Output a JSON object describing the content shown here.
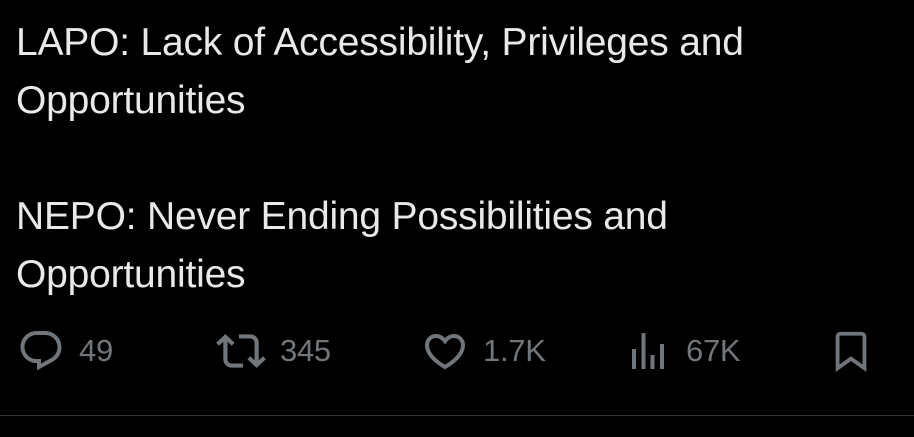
{
  "tweet": {
    "paragraphs": [
      "LAPO: Lack of Accessibility, Privileges and Opportunities",
      "NEPO: Never Ending Possibilities and Opportunities"
    ]
  },
  "actions": {
    "replies": "49",
    "reposts": "345",
    "likes": "1.7K",
    "views": "67K"
  },
  "colors": {
    "background": "#000000",
    "text": "#e7e9ea",
    "muted": "#71767b",
    "divider": "#2f3336"
  },
  "icons": [
    "reply-icon",
    "repost-icon",
    "like-icon",
    "views-icon",
    "bookmark-icon"
  ]
}
